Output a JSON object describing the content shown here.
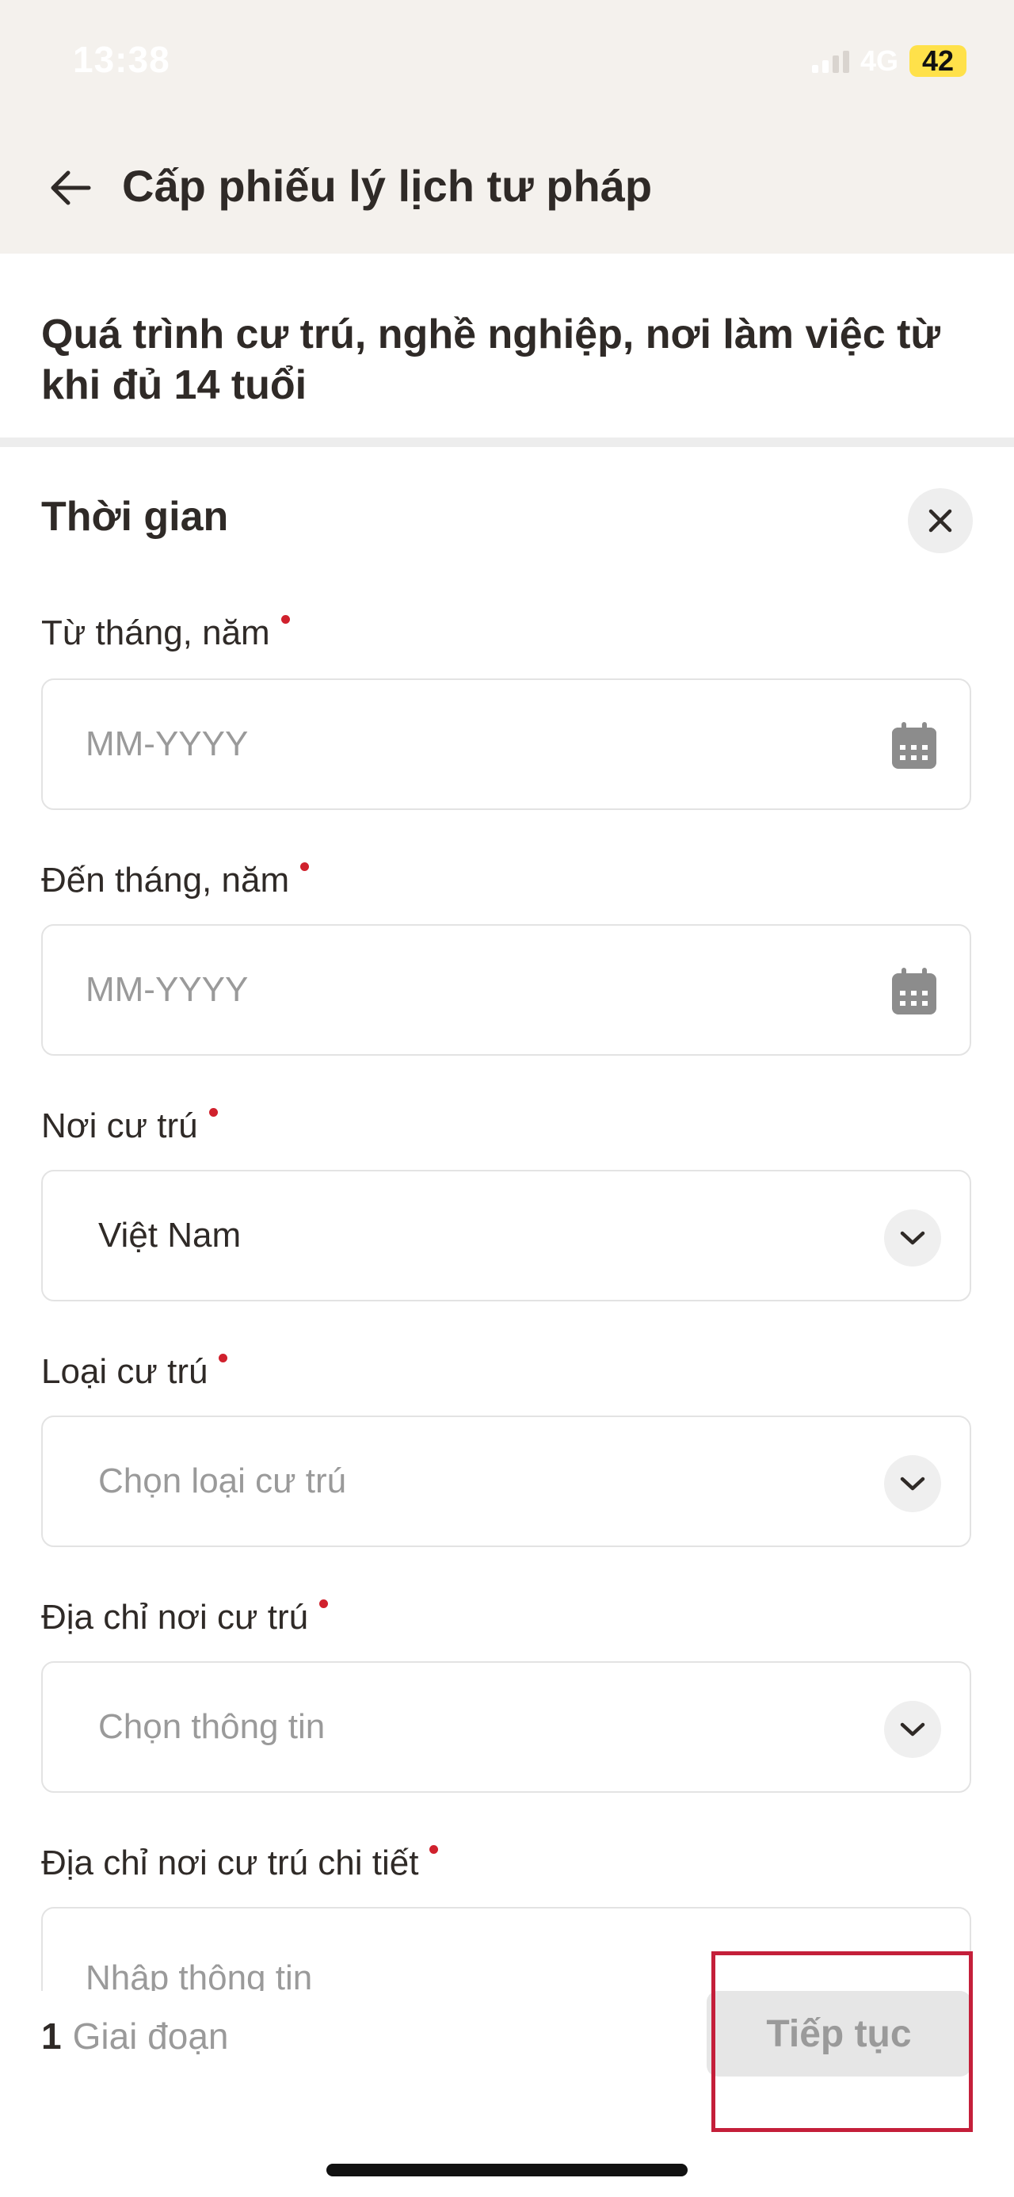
{
  "status_bar": {
    "time": "13:38",
    "network": "4G",
    "battery": "42"
  },
  "app_bar": {
    "title": "Cấp phiếu lý lịch tư pháp"
  },
  "section": {
    "title": "Quá trình cư trú, nghề nghiệp, nơi làm việc từ khi đủ 14 tuổi"
  },
  "card": {
    "title": "Thời gian"
  },
  "fields": {
    "from": {
      "label": "Từ tháng, năm",
      "placeholder": "MM-YYYY"
    },
    "to": {
      "label": "Đến tháng, năm",
      "placeholder": "MM-YYYY"
    },
    "residence_place": {
      "label": "Nơi cư trú",
      "value": "Việt Nam"
    },
    "residence_type": {
      "label": "Loại cư trú",
      "placeholder": "Chọn loại cư trú"
    },
    "residence_address": {
      "label": "Địa chỉ nơi cư trú",
      "placeholder": "Chọn thông tin"
    },
    "residence_detail": {
      "label": "Địa chỉ nơi cư trú chi tiết",
      "placeholder": "Nhập thông tin"
    }
  },
  "footer": {
    "step_number": "1",
    "step_label": "Giai đoạn",
    "next_label": "Tiếp tục"
  },
  "colors": {
    "required": "#d0212d",
    "highlight": "#c41f3a",
    "header_bg": "#f4f1ed"
  }
}
